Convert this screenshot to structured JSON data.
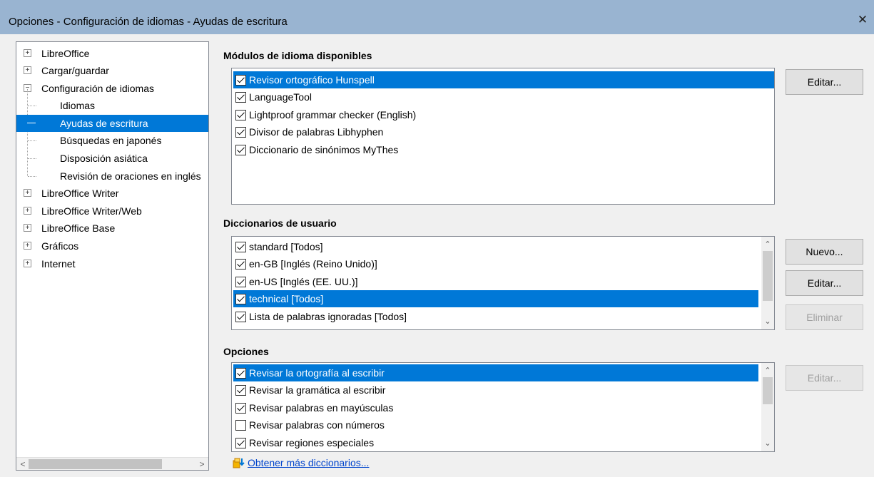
{
  "window": {
    "title": "Opciones - Configuración de idiomas - Ayudas de escritura",
    "close_glyph": "✕"
  },
  "tree": {
    "items": [
      {
        "label": "LibreOffice",
        "expander": "+"
      },
      {
        "label": "Cargar/guardar",
        "expander": "+"
      },
      {
        "label": "Configuración de idiomas",
        "expander": "−"
      },
      {
        "label": "Idiomas"
      },
      {
        "label": "Ayudas de escritura"
      },
      {
        "label": "Búsquedas en japonés"
      },
      {
        "label": "Disposición asiática"
      },
      {
        "label": "Revisión de oraciones en inglés"
      },
      {
        "label": "LibreOffice Writer",
        "expander": "+"
      },
      {
        "label": "LibreOffice Writer/Web",
        "expander": "+"
      },
      {
        "label": "LibreOffice Base",
        "expander": "+"
      },
      {
        "label": "Gráficos",
        "expander": "+"
      },
      {
        "label": "Internet",
        "expander": "+"
      }
    ],
    "selected": "Ayudas de escritura"
  },
  "modules": {
    "title": "Módulos de idioma disponibles",
    "items": [
      {
        "label": "Revisor ortográfico Hunspell",
        "checked": true,
        "selected": true
      },
      {
        "label": "LanguageTool",
        "checked": true
      },
      {
        "label": "Lightproof grammar checker (English)",
        "checked": true
      },
      {
        "label": "Divisor de palabras Libhyphen",
        "checked": true
      },
      {
        "label": "Diccionario de sinónimos MyThes",
        "checked": true
      }
    ],
    "edit_button": "Editar..."
  },
  "user_dicts": {
    "title": "Diccionarios de usuario",
    "items": [
      {
        "label": "standard [Todos]",
        "checked": true
      },
      {
        "label": "en-GB [Inglés (Reino Unido)]",
        "checked": true
      },
      {
        "label": "en-US [Inglés (EE. UU.)]",
        "checked": true
      },
      {
        "label": "technical [Todos]",
        "checked": true,
        "selected": true
      },
      {
        "label": "Lista de palabras ignoradas [Todos]",
        "checked": true
      }
    ],
    "new_button": "Nuevo...",
    "edit_button": "Editar...",
    "delete_button": "Eliminar"
  },
  "options": {
    "title": "Opciones",
    "items": [
      {
        "label": "Revisar la ortografía al escribir",
        "checked": true,
        "selected": true
      },
      {
        "label": "Revisar la gramática al escribir",
        "checked": true
      },
      {
        "label": "Revisar palabras en mayúsculas",
        "checked": true
      },
      {
        "label": "Revisar palabras con números",
        "checked": false
      },
      {
        "label": "Revisar regiones especiales",
        "checked": true
      }
    ],
    "edit_button": "Editar..."
  },
  "more_dicts_link": "Obtener más diccionarios...",
  "colors": {
    "selection": "#0078d7",
    "titlebar": "#99b4d1",
    "link": "#0044cc"
  }
}
